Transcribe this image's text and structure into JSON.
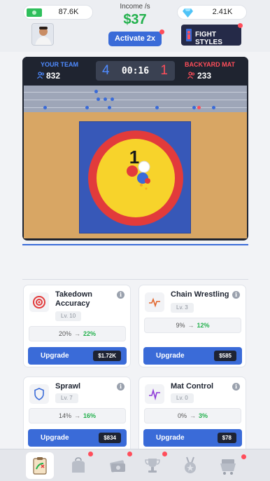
{
  "header": {
    "cash": "87.6K",
    "income_label": "Income /s",
    "income_value": "$37",
    "gems": "2.41K",
    "activate_label": "Activate 2x",
    "fight_styles_label": "FIGHT STYLES"
  },
  "arena": {
    "left_team": "YOUR TEAM",
    "left_count": "832",
    "right_team": "BACKYARD MAT",
    "right_count": "233",
    "left_score": "4",
    "right_score": "1",
    "timer": "00:16",
    "mat_number": "1",
    "colors": {
      "blue_team": "#4f8bff",
      "red_team": "#ff4e5a",
      "mat_blue": "#3758b8",
      "ring_red": "#e23b3b",
      "ring_yellow": "#f7d32b"
    }
  },
  "upgrades": [
    {
      "name": "Takedown Accuracy",
      "level": "Lv. 10",
      "from": "20%",
      "to": "22%",
      "button": "Upgrade",
      "price": "$1.72K",
      "icon": "target-icon"
    },
    {
      "name": "Chain Wrestling",
      "level": "Lv. 3",
      "from": "9%",
      "to": "12%",
      "button": "Upgrade",
      "price": "$585",
      "icon": "pulse-icon"
    },
    {
      "name": "Sprawl",
      "level": "Lv. 7",
      "from": "14%",
      "to": "16%",
      "button": "Upgrade",
      "price": "$834",
      "icon": "shield-icon"
    },
    {
      "name": "Mat Control",
      "level": "Lv. 0",
      "from": "0%",
      "to": "3%",
      "button": "Upgrade",
      "price": "$78",
      "icon": "wave-icon"
    }
  ],
  "nav": [
    "clipboard-icon",
    "bag-icon",
    "cash-stack-icon",
    "trophy-icon",
    "medal-icon",
    "cash-cart-icon"
  ]
}
